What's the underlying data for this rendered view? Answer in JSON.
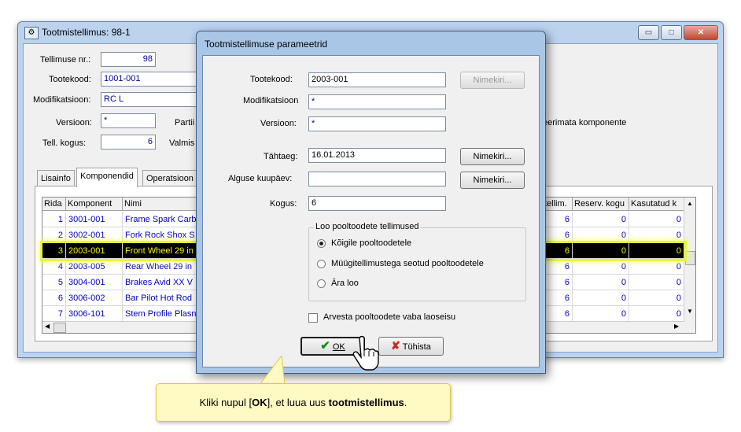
{
  "bg_window": {
    "title": "Tootmistellimus: 98-1",
    "minimize": "▭",
    "maximize": "□",
    "close": "✕",
    "fields": {
      "tellimuse_nr_label": "Tellimuse nr.:",
      "tellimuse_nr_value": "98",
      "tootekood_label": "Tootekood:",
      "tootekood_value": "1001-001",
      "modifikatsioon_label": "Modifikatsioon:",
      "modifikatsioon_value": "RC L",
      "versioon_label": "Versioon:",
      "versioon_value": "*",
      "partii_label": "Partii",
      "tell_kogus_label": "Tell. kogus:",
      "tell_kogus_value": "6",
      "valmis_label": "Valmis",
      "side_text": "eerimata komponente"
    },
    "tabs": [
      "Lisainfo",
      "Komponendid",
      "Operatsioon"
    ],
    "grid": {
      "columns": [
        "Rida",
        "Komponent",
        "Nimi",
        "tellim.",
        "Reserv. kogu",
        "Kasutatud k"
      ],
      "rows": [
        {
          "rida": "1",
          "komponent": "3001-001",
          "nimi": "Frame Spark Carb",
          "tellim": "6",
          "reserv": "0",
          "kasutatud": "0"
        },
        {
          "rida": "2",
          "komponent": "3002-001",
          "nimi": "Fork Rock Shox S",
          "tellim": "6",
          "reserv": "0",
          "kasutatud": "0"
        },
        {
          "rida": "3",
          "komponent": "2003-001",
          "nimi": "Front Wheel 29 in",
          "tellim": "6",
          "reserv": "0",
          "kasutatud": "0"
        },
        {
          "rida": "4",
          "komponent": "2003-005",
          "nimi": "Rear Wheel 29 in",
          "tellim": "6",
          "reserv": "0",
          "kasutatud": "0"
        },
        {
          "rida": "5",
          "komponent": "3004-001",
          "nimi": "Brakes Avid XX V",
          "tellim": "6",
          "reserv": "0",
          "kasutatud": "0"
        },
        {
          "rida": "6",
          "komponent": "3006-002",
          "nimi": "Bar Pilot Hot Rod",
          "tellim": "6",
          "reserv": "0",
          "kasutatud": "0"
        },
        {
          "rida": "7",
          "komponent": "3006-101",
          "nimi": "Stem Profile Plasn",
          "tellim": "6",
          "reserv": "0",
          "kasutatud": "0"
        }
      ]
    }
  },
  "dialog": {
    "title": "Tootmistellimuse parameetrid",
    "tootekood_label": "Tootekood:",
    "tootekood_value": "2003-001",
    "modifikatsioon_label": "Modifikatsioon",
    "modifikatsioon_value": "*",
    "versioon_label": "Versioon:",
    "versioon_value": "*",
    "tahtaeg_label": "Tähtaeg:",
    "tahtaeg_value": "16.01.2013",
    "alguse_label": "Alguse kuupäev:",
    "alguse_value": "",
    "kogus_label": "Kogus:",
    "kogus_value": "6",
    "nimekiri": "Nimekiri...",
    "group_title": "Loo pooltoodete tellimused",
    "radio1": "Kõigile pooltoodetele",
    "radio2": "Müügitellimustega seotud pooltoodetele",
    "radio3": "Ära loo",
    "checkbox": "Arvesta pooltoodete vaba laoseisu",
    "ok": "OK",
    "cancel": "Tühista"
  },
  "tooltip": {
    "pre": "Kliki nupul [",
    "ok": "OK",
    "mid": "], et luua uus ",
    "bold": "tootmistellimus",
    "post": "."
  },
  "colors": {
    "highlight": "#f3ff59",
    "ok_check": "#1a8a1a",
    "cancel_x": "#c8281e"
  }
}
